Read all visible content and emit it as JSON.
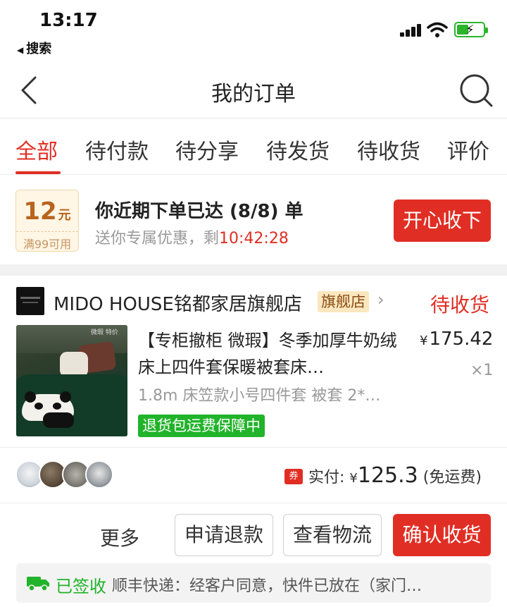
{
  "status_bar": {
    "time": "13:17",
    "back_app": "搜索",
    "icons": [
      "signal-icon",
      "wifi-icon",
      "battery-charging-icon"
    ],
    "battery_color": "#2bb52b"
  },
  "header": {
    "title": "我的订单",
    "back_icon": "chevron-left-icon",
    "search_icon": "search-icon"
  },
  "tabs": [
    {
      "label": "全部",
      "active": true
    },
    {
      "label": "待付款",
      "active": false
    },
    {
      "label": "待分享",
      "active": false
    },
    {
      "label": "待发货",
      "active": false
    },
    {
      "label": "待收货",
      "active": false
    },
    {
      "label": "评价",
      "active": false
    }
  ],
  "coupon_banner": {
    "amount": "12",
    "unit": "元",
    "condition": "满99可用",
    "headline": "你近期下单已达 (8/8) 单",
    "sub_prefix": "送你专属优惠，剩",
    "countdown": "10:42:28",
    "button_label": "开心收下"
  },
  "order": {
    "store_name": "MIDO HOUSE铭都家居旗舰店",
    "flagship_badge": "旗舰店",
    "status": "待收货",
    "product": {
      "title": "【专柜撤柜 微瑕】冬季加厚牛奶绒床上四件套保暖被套床…",
      "image_tag": "微瑕 特价",
      "spec": "1.8m 床笠款小号四件套 被套 2*…",
      "guarantee": "退货包运费保障中",
      "price_symbol": "¥",
      "price": "175.42",
      "quantity": "×1"
    },
    "payment": {
      "coupon_label": "券",
      "paid_label": "实付:",
      "currency": "¥",
      "amount": "125.3",
      "shipping_note": "(免运费)"
    },
    "actions": {
      "more": "更多",
      "refund": "申请退款",
      "logistics": "查看物流",
      "confirm": "确认收货"
    },
    "logistics": {
      "status": "已签收",
      "detail": "顺丰快递：经客户同意，快件已放在（家门…"
    }
  },
  "colors": {
    "accent_red": "#e02e24",
    "success_green": "#21b32a",
    "coupon_brown": "#b8641e"
  }
}
